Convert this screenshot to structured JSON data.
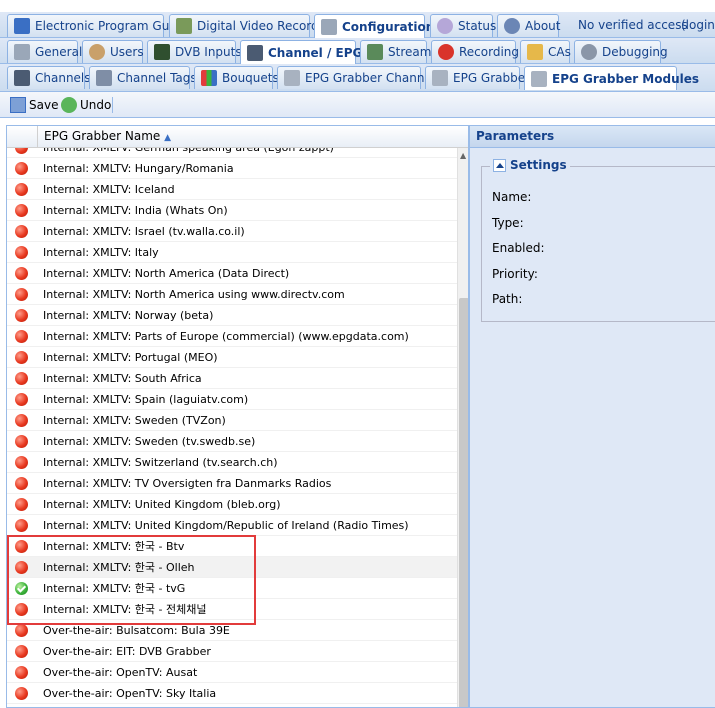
{
  "tabs_l1": {
    "epg": "Electronic Program Guide",
    "dvr": "Digital Video Recorder",
    "config": "Configuration",
    "status": "Status",
    "about": "About",
    "access": "No verified access",
    "login": "(login)"
  },
  "tabs_l2": {
    "general": "General",
    "users": "Users",
    "dvb": "DVB Inputs",
    "channel": "Channel / EPG",
    "stream": "Stream",
    "recording": "Recording",
    "cas": "CAs",
    "debugging": "Debugging"
  },
  "tabs_l3": {
    "channels": "Channels",
    "tags": "Channel Tags",
    "bouquets": "Bouquets",
    "grabber_channels": "EPG Grabber Channels",
    "grabber": "EPG Grabber",
    "modules": "EPG Grabber Modules"
  },
  "toolbar": {
    "save": "Save",
    "undo": "Undo"
  },
  "grid": {
    "column": "EPG Grabber Name",
    "rows": [
      {
        "name": "Internal: XMLTV: German speaking area (Egon zappt)",
        "status": "red"
      },
      {
        "name": "Internal: XMLTV: Hungary/Romania",
        "status": "red"
      },
      {
        "name": "Internal: XMLTV: Iceland",
        "status": "red"
      },
      {
        "name": "Internal: XMLTV: India (Whats On)",
        "status": "red"
      },
      {
        "name": "Internal: XMLTV: Israel (tv.walla.co.il)",
        "status": "red"
      },
      {
        "name": "Internal: XMLTV: Italy",
        "status": "red"
      },
      {
        "name": "Internal: XMLTV: North America (Data Direct)",
        "status": "red"
      },
      {
        "name": "Internal: XMLTV: North America using www.directv.com",
        "status": "red"
      },
      {
        "name": "Internal: XMLTV: Norway (beta)",
        "status": "red"
      },
      {
        "name": "Internal: XMLTV: Parts of Europe (commercial) (www.epgdata.com)",
        "status": "red"
      },
      {
        "name": "Internal: XMLTV: Portugal (MEO)",
        "status": "red"
      },
      {
        "name": "Internal: XMLTV: South Africa",
        "status": "red"
      },
      {
        "name": "Internal: XMLTV: Spain (laguiatv.com)",
        "status": "red"
      },
      {
        "name": "Internal: XMLTV: Sweden (TVZon)",
        "status": "red"
      },
      {
        "name": "Internal: XMLTV: Sweden (tv.swedb.se)",
        "status": "red"
      },
      {
        "name": "Internal: XMLTV: Switzerland (tv.search.ch)",
        "status": "red"
      },
      {
        "name": "Internal: XMLTV: TV Oversigten fra Danmarks Radios",
        "status": "red"
      },
      {
        "name": "Internal: XMLTV: United Kingdom (bleb.org)",
        "status": "red"
      },
      {
        "name": "Internal: XMLTV: United Kingdom/Republic of Ireland (Radio Times)",
        "status": "red"
      },
      {
        "name": "Internal: XMLTV: 한국 - Btv",
        "status": "red"
      },
      {
        "name": "Internal: XMLTV: 한국 - Olleh",
        "status": "red"
      },
      {
        "name": "Internal: XMLTV: 한국 - tvG",
        "status": "green"
      },
      {
        "name": "Internal: XMLTV: 한국 - 전체채널",
        "status": "red"
      },
      {
        "name": "Over-the-air: Bulsatcom: Bula 39E",
        "status": "red"
      },
      {
        "name": "Over-the-air: EIT: DVB Grabber",
        "status": "red"
      },
      {
        "name": "Over-the-air: OpenTV: Ausat",
        "status": "red"
      },
      {
        "name": "Over-the-air: OpenTV: Sky Italia",
        "status": "red"
      }
    ]
  },
  "panel": {
    "title": "Parameters",
    "settings": "Settings",
    "fields": [
      "Name:",
      "Type:",
      "Enabled:",
      "Priority:",
      "Path:"
    ]
  },
  "colors": {
    "accent": "#15428b",
    "highlight": "#e23b3b"
  }
}
